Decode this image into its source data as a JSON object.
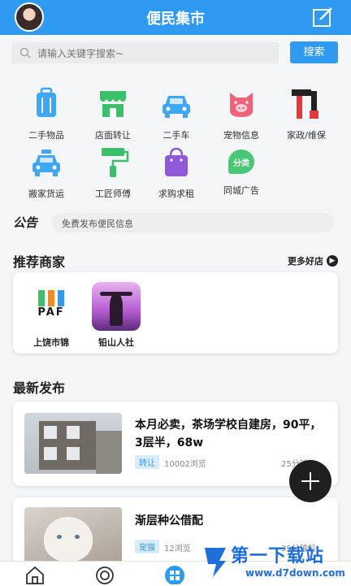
{
  "header": {
    "title": "便民集市"
  },
  "search": {
    "placeholder": "请输入关键字搜索~",
    "button_label": "搜索"
  },
  "categories": [
    {
      "label": "二手物品",
      "icon": "suitcase-icon"
    },
    {
      "label": "店面转让",
      "icon": "shopfront-icon"
    },
    {
      "label": "二手车",
      "icon": "car-icon"
    },
    {
      "label": "宠物信息",
      "icon": "pig-icon"
    },
    {
      "label": "家政/维保",
      "icon": "tools-icon"
    },
    {
      "label": "搬家货运",
      "icon": "taxi-icon"
    },
    {
      "label": "工匠师傅",
      "icon": "paint-roller-icon"
    },
    {
      "label": "求购求租",
      "icon": "shopping-bag-icon"
    },
    {
      "label": "同城广告",
      "icon": "ad-icon"
    }
  ],
  "ad_badge": "分类",
  "notice": {
    "logo": "公告",
    "text": "免费发布便民信息"
  },
  "merchants": {
    "title": "推荐商家",
    "more_label": "更多好店",
    "items": [
      {
        "name": "上饶市锦",
        "logo_text": "PAF"
      },
      {
        "name": "铅山人社"
      }
    ]
  },
  "posts_section": {
    "title": "最新发布"
  },
  "posts": [
    {
      "title": "本月必卖，茶场学校自建房，90平，3层半，68w",
      "tag": "转让",
      "views": "10002浏览",
      "time": "25分钟前"
    },
    {
      "title": "渐层种公借配",
      "tag": "宠猫",
      "views": "12浏览",
      "time": "39分钟前"
    }
  ],
  "watermark": {
    "text": "第一下载站",
    "url": "www.d7down.com"
  },
  "colors": {
    "primary": "#2e9af2",
    "fab": "#1f1f1f"
  }
}
